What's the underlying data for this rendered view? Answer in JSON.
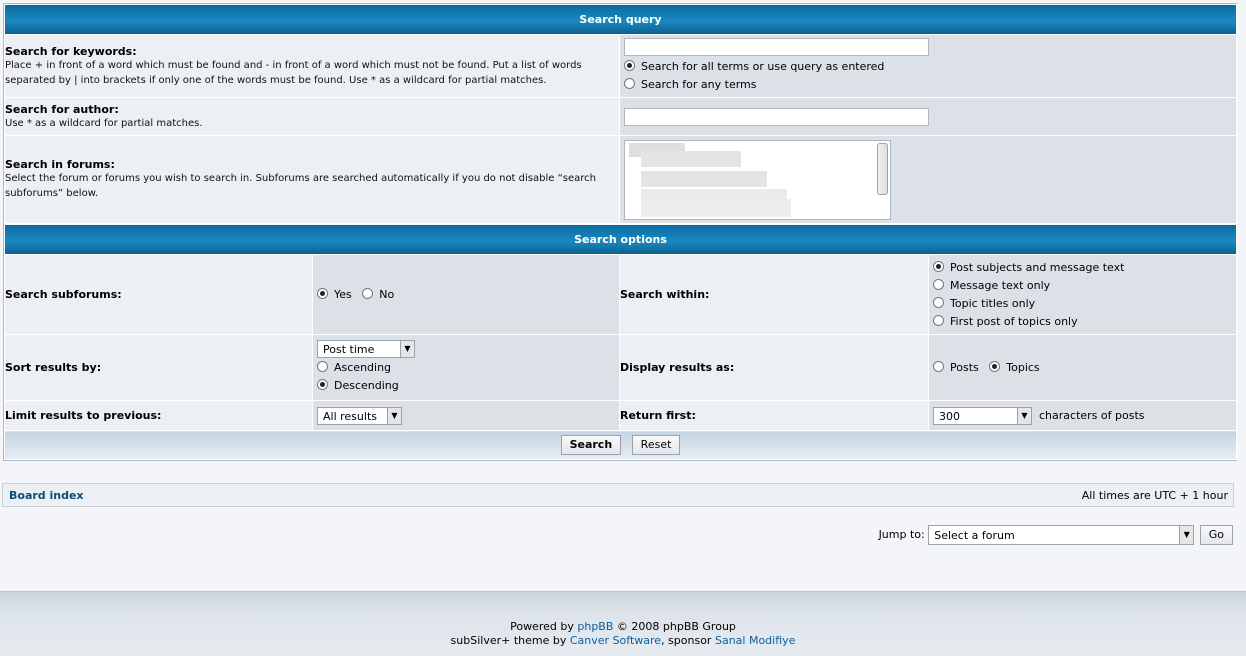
{
  "search_query": {
    "header": "Search query",
    "keywords": {
      "label": "Search for keywords:",
      "desc": "Place + in front of a word which must be found and - in front of a word which must not be found. Put a list of words separated by | into brackets if only one of the words must be found. Use * as a wildcard for partial matches.",
      "value": "",
      "options": [
        "Search for all terms or use query as entered",
        "Search for any terms"
      ]
    },
    "author": {
      "label": "Search for author:",
      "desc": "Use * as a wildcard for partial matches.",
      "value": ""
    },
    "forums": {
      "label": "Search in forums:",
      "desc": "Select the forum or forums you wish to search in. Subforums are searched automatically if you do not disable “search subforums” below."
    }
  },
  "search_options": {
    "header": "Search options",
    "subforums": {
      "label": "Search subforums:",
      "yes": "Yes",
      "no": "No"
    },
    "within": {
      "label": "Search within:",
      "options": [
        "Post subjects and message text",
        "Message text only",
        "Topic titles only",
        "First post of topics only"
      ]
    },
    "sort": {
      "label": "Sort results by:",
      "selected": "Post time",
      "asc": "Ascending",
      "desc": "Descending"
    },
    "display": {
      "label": "Display results as:",
      "posts": "Posts",
      "topics": "Topics"
    },
    "limit": {
      "label": "Limit results to previous:",
      "selected": "All results"
    },
    "return_first": {
      "label": "Return first:",
      "selected": "300",
      "suffix": "characters of posts"
    }
  },
  "buttons": {
    "search": "Search",
    "reset": "Reset",
    "go": "Go"
  },
  "navbar": {
    "board_index": "Board index",
    "timezone": "All times are UTC + 1 hour"
  },
  "jump": {
    "label": "Jump to:",
    "selected": "Select a forum"
  },
  "footer": {
    "powered_by": "Powered by",
    "phpbb": "phpBB",
    "copyright": "© 2008 phpBB Group",
    "theme_prefix": "subSilver+ theme by",
    "canver": "Canver Software",
    "sponsor_prefix": ", sponsor",
    "sanal": "Sanal Modifiye"
  },
  "colors": {
    "header_blue": "#0b6da2",
    "row_light": "#eceff4",
    "row_dark": "#dce1e8",
    "link": "#0b4d78"
  }
}
